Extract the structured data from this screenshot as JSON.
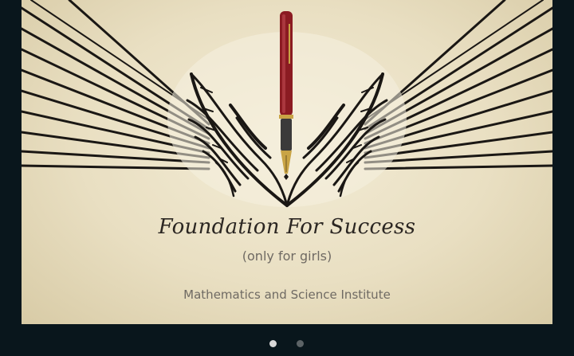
{
  "slide": {
    "title": "Foundation For Success",
    "subtitle": "(only for girls)",
    "institute": "Mathematics and Science Institute"
  },
  "logo": {
    "icons": [
      "fountain-pen-icon",
      "wings-icon"
    ],
    "colors": {
      "pen": "#8b1b22",
      "nib": "#c9a445",
      "ink": "#1a1714"
    }
  },
  "carousel": {
    "slide_count": 2,
    "active_index": 0
  },
  "colors": {
    "background": "#09161c",
    "paper": "#ebe2c7",
    "dot_active": "#d8d8d8",
    "dot_inactive": "#5c6366"
  }
}
